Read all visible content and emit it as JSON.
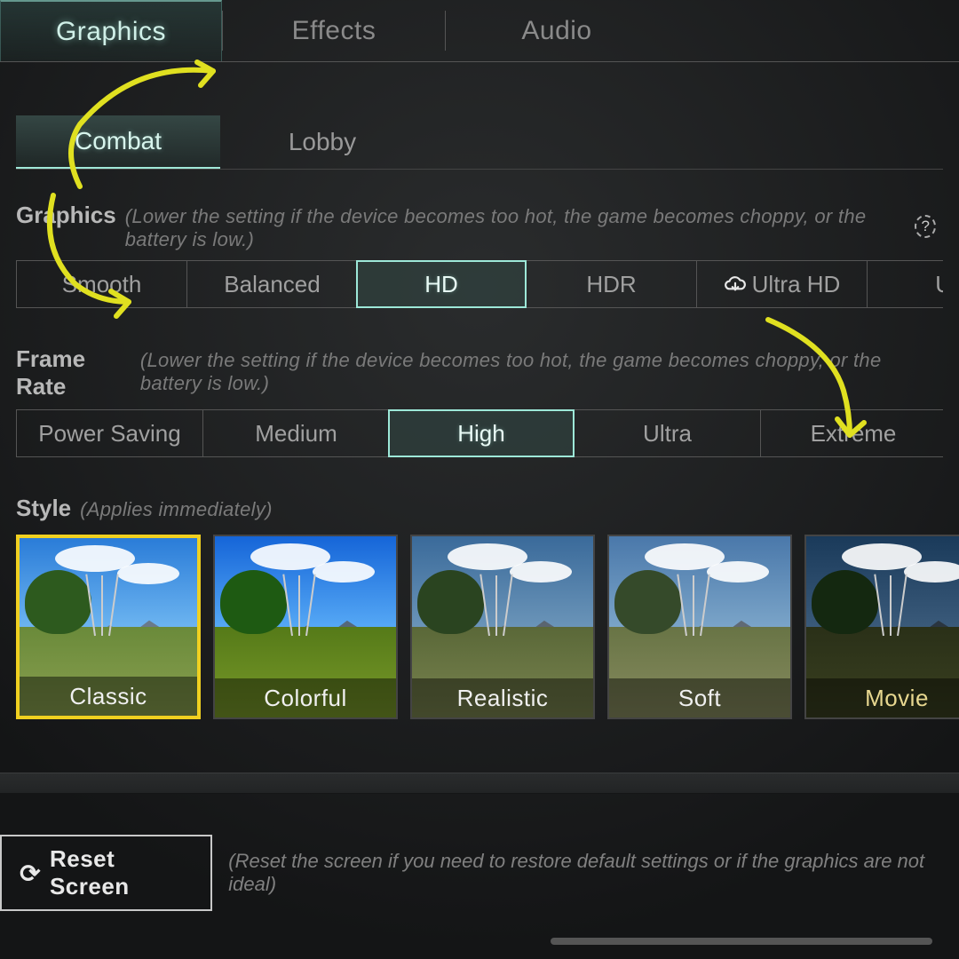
{
  "top_tabs": {
    "graphics": "Graphics",
    "effects": "Effects",
    "audio": "Audio",
    "active": "graphics"
  },
  "sub_tabs": {
    "combat": "Combat",
    "lobby": "Lobby",
    "active": "combat"
  },
  "graphics": {
    "title": "Graphics",
    "hint": "(Lower the setting if the device becomes too hot, the game becomes choppy, or the battery is low.)",
    "help": "?",
    "options": {
      "smooth": "Smooth",
      "balanced": "Balanced",
      "hd": "HD",
      "hdr": "HDR",
      "ultrahd": "Ultra HD",
      "uhd": "UH",
      "selected": "hd",
      "download_icon_on": "ultrahd"
    }
  },
  "framerate": {
    "title": "Frame Rate",
    "hint": "(Lower the setting if the device becomes too hot, the game becomes choppy, or the battery is low.)",
    "options": {
      "power": "Power Saving",
      "medium": "Medium",
      "high": "High",
      "ultra": "Ultra",
      "extreme": "Extreme",
      "selected": "high"
    }
  },
  "style": {
    "title": "Style",
    "hint": "(Applies immediately)",
    "tiles": {
      "classic": "Classic",
      "colorful": "Colorful",
      "realistic": "Realistic",
      "soft": "Soft",
      "movie": "Movie",
      "selected": "classic"
    }
  },
  "reset": {
    "label": "Reset Screen",
    "hint": "(Reset the screen if you need to restore default settings or if the graphics are not ideal)"
  }
}
